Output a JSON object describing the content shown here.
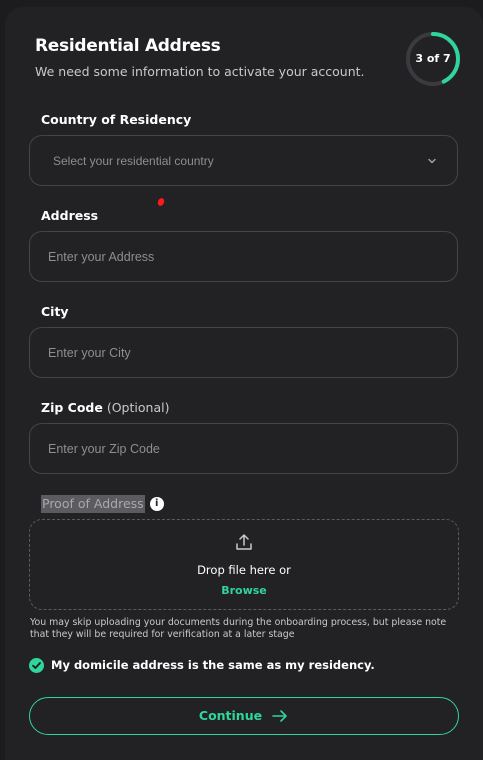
{
  "header": {
    "title": "Residential Address",
    "subtitle": "We need some information to activate your account.",
    "progress_label": "3 of 7",
    "progress": {
      "step": 3,
      "total": 7
    }
  },
  "country": {
    "label": "Country of Residency",
    "placeholder": "Select your residential country"
  },
  "address": {
    "label": "Address",
    "placeholder": "Enter your Address"
  },
  "city": {
    "label": "City",
    "placeholder": "Enter your City"
  },
  "zip": {
    "label": "Zip Code",
    "optional": "(Optional)",
    "placeholder": "Enter your Zip Code"
  },
  "proof": {
    "label": "Proof of Address",
    "info_icon": "i",
    "drop_text": "Drop file here or",
    "browse_label": "Browse",
    "note": "You may skip uploading your documents during the onboarding process, but please note that they will be required for verification at a later stage"
  },
  "domicile": {
    "checked": true,
    "label": "My domicile address is the same as my residency."
  },
  "continue": {
    "label": "Continue"
  },
  "colors": {
    "accent": "#2fd59a",
    "background": "#1c1c1f",
    "card": "#222225",
    "annotation_dot": "#ff1a1a"
  },
  "icons": {
    "select": "chevron-down-icon",
    "upload": "upload-icon",
    "check": "check-icon",
    "continue": "arrow-right-icon",
    "info": "info-icon"
  }
}
